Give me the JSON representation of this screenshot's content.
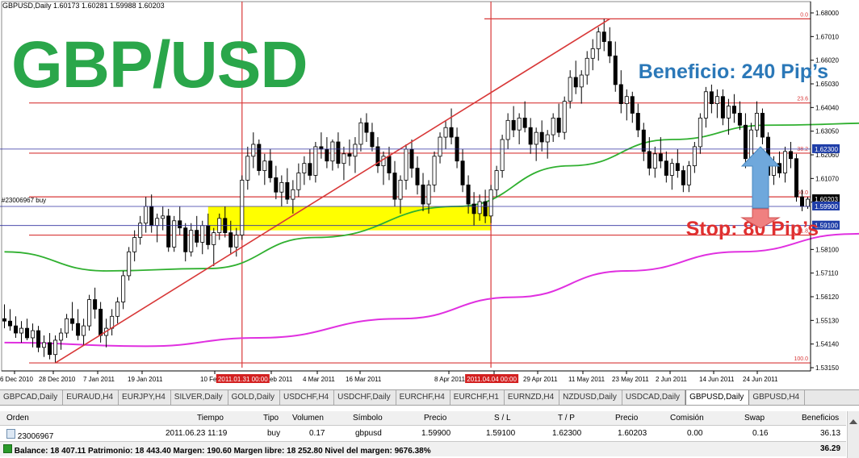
{
  "chart_header": "GBPUSD,Daily  1.60173 1.60281 1.59988 1.60203",
  "big_title": "GBP/USD",
  "profit_label": "Beneficio: 240 Pip’s",
  "stop_label": "Stop: 80 Pip’s",
  "order_label": "#23006967 buy",
  "colors": {
    "title_green": "#2aa64a",
    "profit_blue": "#2b78b8",
    "stop_red": "#e03030",
    "fib_red": "#d83838",
    "ma_green": "#30b030",
    "ma_magenta": "#e030e0",
    "buy_zone_yellow": "#ffff00",
    "price_line_blue": "#3030a0"
  },
  "icons": [
    "up-arrow-icon",
    "down-arrow-icon",
    "order-icon",
    "balance-icon"
  ],
  "chart_data": {
    "type": "candlestick",
    "symbol": "GBPUSD",
    "timeframe": "Daily",
    "ylim": [
      1.5315,
      1.68
    ],
    "x_tick_labels": [
      "6 Dec 2010",
      "28 Dec 2010",
      "7 Jan 2011",
      "19 Jan 2011",
      "10 Feb 2011",
      "22 Feb 2011",
      "4 Mar 2011",
      "16 Mar 2011",
      "8 Apr 2011",
      "19 Apr 2011",
      "29 Apr 2011",
      "11 May 2011",
      "23 May 2011",
      "2 Jun 2011",
      "14 Jun 2011",
      "24 Jun 2011"
    ],
    "y_tick_labels": [
      "1.68000",
      "1.67010",
      "1.66020",
      "1.65030",
      "1.64040",
      "1.63050",
      "1.62060",
      "1.61070",
      "1.60080",
      "1.59090",
      "1.58100",
      "1.57110",
      "1.56120",
      "1.55130",
      "1.54140",
      "1.53150"
    ],
    "fib_levels": [
      {
        "label": "0.0",
        "price": 1.6775
      },
      {
        "label": "23.6",
        "price": 1.6423
      },
      {
        "label": "38.2",
        "price": 1.6213
      },
      {
        "label": "50.0",
        "price": 1.603
      },
      {
        "label": "61.8",
        "price": 1.587
      },
      {
        "label": "100.0",
        "price": 1.5335
      }
    ],
    "price_labels": [
      {
        "text": "1.62300",
        "price": 1.623
      },
      {
        "text": "1.60203",
        "price": 1.60203
      },
      {
        "text": "1.59900",
        "price": 1.599
      },
      {
        "text": "1.59100",
        "price": 1.591
      }
    ],
    "vertical_markers": [
      {
        "text": "2011.01.31 00:00",
        "index": 42
      },
      {
        "text": "2011.04.04 00:00",
        "index": 86
      }
    ],
    "trendline": {
      "from_index": 9,
      "from_price": 1.5335,
      "to_index": 107,
      "to_price": 1.6775
    },
    "buy_zone": {
      "from_index": 36,
      "to_index": 86,
      "low": 1.589,
      "high": 1.599
    },
    "ohlc": [
      [
        1.552,
        1.558,
        1.548,
        1.551
      ],
      [
        1.551,
        1.556,
        1.547,
        1.549
      ],
      [
        1.549,
        1.553,
        1.544,
        1.546
      ],
      [
        1.546,
        1.551,
        1.542,
        1.548
      ],
      [
        1.548,
        1.552,
        1.543,
        1.544
      ],
      [
        1.544,
        1.55,
        1.54,
        1.547
      ],
      [
        1.547,
        1.549,
        1.538,
        1.54
      ],
      [
        1.54,
        1.545,
        1.536,
        1.542
      ],
      [
        1.542,
        1.546,
        1.535,
        1.537
      ],
      [
        1.537,
        1.545,
        1.5335,
        1.543
      ],
      [
        1.543,
        1.548,
        1.539,
        1.546
      ],
      [
        1.546,
        1.554,
        1.544,
        1.552
      ],
      [
        1.552,
        1.559,
        1.547,
        1.55
      ],
      [
        1.55,
        1.556,
        1.543,
        1.545
      ],
      [
        1.545,
        1.552,
        1.541,
        1.549
      ],
      [
        1.549,
        1.562,
        1.547,
        1.56
      ],
      [
        1.56,
        1.565,
        1.552,
        1.556
      ],
      [
        1.556,
        1.559,
        1.542,
        1.545
      ],
      [
        1.545,
        1.552,
        1.54,
        1.548
      ],
      [
        1.548,
        1.556,
        1.545,
        1.553
      ],
      [
        1.553,
        1.561,
        1.55,
        1.559
      ],
      [
        1.559,
        1.572,
        1.556,
        1.57
      ],
      [
        1.57,
        1.582,
        1.568,
        1.58
      ],
      [
        1.58,
        1.589,
        1.576,
        1.586
      ],
      [
        1.586,
        1.595,
        1.583,
        1.592
      ],
      [
        1.592,
        1.603,
        1.588,
        1.599
      ],
      [
        1.599,
        1.604,
        1.588,
        1.591
      ],
      [
        1.591,
        1.596,
        1.584,
        1.594
      ],
      [
        1.594,
        1.599,
        1.589,
        1.595
      ],
      [
        1.595,
        1.598,
        1.58,
        1.582
      ],
      [
        1.582,
        1.595,
        1.58,
        1.593
      ],
      [
        1.593,
        1.599,
        1.587,
        1.59
      ],
      [
        1.59,
        1.592,
        1.576,
        1.58
      ],
      [
        1.58,
        1.592,
        1.578,
        1.589
      ],
      [
        1.589,
        1.595,
        1.582,
        1.584
      ],
      [
        1.584,
        1.593,
        1.579,
        1.591
      ],
      [
        1.591,
        1.596,
        1.581,
        1.583
      ],
      [
        1.583,
        1.59,
        1.574,
        1.588
      ],
      [
        1.588,
        1.596,
        1.585,
        1.594
      ],
      [
        1.594,
        1.599,
        1.586,
        1.588
      ],
      [
        1.588,
        1.593,
        1.579,
        1.582
      ],
      [
        1.582,
        1.59,
        1.578,
        1.587
      ],
      [
        1.587,
        1.612,
        1.585,
        1.61
      ],
      [
        1.61,
        1.624,
        1.606,
        1.62
      ],
      [
        1.62,
        1.63,
        1.615,
        1.625
      ],
      [
        1.625,
        1.627,
        1.612,
        1.614
      ],
      [
        1.614,
        1.621,
        1.608,
        1.618
      ],
      [
        1.618,
        1.623,
        1.609,
        1.611
      ],
      [
        1.611,
        1.616,
        1.602,
        1.605
      ],
      [
        1.605,
        1.612,
        1.599,
        1.609
      ],
      [
        1.609,
        1.615,
        1.6,
        1.602
      ],
      [
        1.602,
        1.61,
        1.596,
        1.606
      ],
      [
        1.606,
        1.617,
        1.603,
        1.613
      ],
      [
        1.613,
        1.62,
        1.608,
        1.617
      ],
      [
        1.617,
        1.623,
        1.61,
        1.612
      ],
      [
        1.612,
        1.626,
        1.609,
        1.624
      ],
      [
        1.624,
        1.63,
        1.619,
        1.623
      ],
      [
        1.623,
        1.628,
        1.615,
        1.618
      ],
      [
        1.618,
        1.627,
        1.614,
        1.626
      ],
      [
        1.626,
        1.63,
        1.615,
        1.617
      ],
      [
        1.617,
        1.624,
        1.61,
        1.621
      ],
      [
        1.621,
        1.627,
        1.616,
        1.62
      ],
      [
        1.62,
        1.628,
        1.613,
        1.625
      ],
      [
        1.625,
        1.636,
        1.622,
        1.634
      ],
      [
        1.634,
        1.638,
        1.626,
        1.63
      ],
      [
        1.63,
        1.634,
        1.622,
        1.624
      ],
      [
        1.624,
        1.628,
        1.613,
        1.616
      ],
      [
        1.616,
        1.622,
        1.608,
        1.62
      ],
      [
        1.62,
        1.624,
        1.61,
        1.613
      ],
      [
        1.613,
        1.618,
        1.599,
        1.602
      ],
      [
        1.602,
        1.612,
        1.596,
        1.61
      ],
      [
        1.61,
        1.625,
        1.606,
        1.623
      ],
      [
        1.623,
        1.627,
        1.611,
        1.615
      ],
      [
        1.615,
        1.62,
        1.604,
        1.608
      ],
      [
        1.608,
        1.613,
        1.597,
        1.6
      ],
      [
        1.6,
        1.61,
        1.596,
        1.608
      ],
      [
        1.608,
        1.622,
        1.605,
        1.62
      ],
      [
        1.62,
        1.63,
        1.617,
        1.628
      ],
      [
        1.628,
        1.635,
        1.623,
        1.632
      ],
      [
        1.632,
        1.64,
        1.625,
        1.628
      ],
      [
        1.628,
        1.632,
        1.615,
        1.618
      ],
      [
        1.618,
        1.623,
        1.605,
        1.608
      ],
      [
        1.608,
        1.612,
        1.596,
        1.6
      ],
      [
        1.6,
        1.605,
        1.591,
        1.596
      ],
      [
        1.596,
        1.604,
        1.593,
        1.601
      ],
      [
        1.601,
        1.606,
        1.592,
        1.595
      ],
      [
        1.595,
        1.608,
        1.592,
        1.606
      ],
      [
        1.606,
        1.616,
        1.603,
        1.614
      ],
      [
        1.614,
        1.629,
        1.611,
        1.627
      ],
      [
        1.627,
        1.638,
        1.623,
        1.635
      ],
      [
        1.635,
        1.641,
        1.628,
        1.631
      ],
      [
        1.631,
        1.638,
        1.625,
        1.636
      ],
      [
        1.636,
        1.643,
        1.63,
        1.632
      ],
      [
        1.632,
        1.636,
        1.621,
        1.625
      ],
      [
        1.625,
        1.632,
        1.618,
        1.63
      ],
      [
        1.63,
        1.635,
        1.622,
        1.626
      ],
      [
        1.626,
        1.631,
        1.619,
        1.629
      ],
      [
        1.629,
        1.638,
        1.626,
        1.636
      ],
      [
        1.636,
        1.642,
        1.628,
        1.63
      ],
      [
        1.63,
        1.645,
        1.627,
        1.643
      ],
      [
        1.643,
        1.656,
        1.64,
        1.653
      ],
      [
        1.653,
        1.66,
        1.646,
        1.649
      ],
      [
        1.649,
        1.656,
        1.642,
        1.654
      ],
      [
        1.654,
        1.664,
        1.65,
        1.661
      ],
      [
        1.661,
        1.669,
        1.656,
        1.665
      ],
      [
        1.665,
        1.674,
        1.66,
        1.672
      ],
      [
        1.672,
        1.6775,
        1.664,
        1.668
      ],
      [
        1.668,
        1.674,
        1.659,
        1.662
      ],
      [
        1.662,
        1.668,
        1.647,
        1.65
      ],
      [
        1.65,
        1.656,
        1.638,
        1.642
      ],
      [
        1.642,
        1.648,
        1.635,
        1.645
      ],
      [
        1.645,
        1.647,
        1.634,
        1.638
      ],
      [
        1.638,
        1.642,
        1.628,
        1.631
      ],
      [
        1.631,
        1.634,
        1.618,
        1.622
      ],
      [
        1.622,
        1.628,
        1.612,
        1.615
      ],
      [
        1.615,
        1.624,
        1.611,
        1.621
      ],
      [
        1.621,
        1.628,
        1.615,
        1.618
      ],
      [
        1.618,
        1.622,
        1.609,
        1.612
      ],
      [
        1.612,
        1.619,
        1.606,
        1.617
      ],
      [
        1.617,
        1.623,
        1.611,
        1.614
      ],
      [
        1.614,
        1.616,
        1.605,
        1.608
      ],
      [
        1.608,
        1.618,
        1.605,
        1.616
      ],
      [
        1.616,
        1.626,
        1.613,
        1.624
      ],
      [
        1.624,
        1.638,
        1.621,
        1.636
      ],
      [
        1.636,
        1.649,
        1.632,
        1.647
      ],
      [
        1.647,
        1.65,
        1.638,
        1.642
      ],
      [
        1.642,
        1.648,
        1.636,
        1.645
      ],
      [
        1.645,
        1.648,
        1.633,
        1.636
      ],
      [
        1.636,
        1.644,
        1.629,
        1.641
      ],
      [
        1.641,
        1.646,
        1.634,
        1.638
      ],
      [
        1.638,
        1.643,
        1.631,
        1.633
      ],
      [
        1.633,
        1.638,
        1.615,
        1.619
      ],
      [
        1.619,
        1.634,
        1.617,
        1.631
      ],
      [
        1.631,
        1.643,
        1.628,
        1.638
      ],
      [
        1.638,
        1.64,
        1.625,
        1.628
      ],
      [
        1.628,
        1.63,
        1.609,
        1.612
      ],
      [
        1.612,
        1.62,
        1.608,
        1.617
      ],
      [
        1.617,
        1.622,
        1.611,
        1.613
      ],
      [
        1.613,
        1.624,
        1.609,
        1.622
      ],
      [
        1.622,
        1.626,
        1.615,
        1.619
      ],
      [
        1.619,
        1.621,
        1.601,
        1.603
      ],
      [
        1.603,
        1.606,
        1.597,
        1.599
      ],
      [
        1.599,
        1.603,
        1.598,
        1.60203
      ]
    ],
    "ma_green_endpoints": [
      {
        "index": 0,
        "price": 1.58
      },
      {
        "index": 18,
        "price": 1.572
      },
      {
        "index": 36,
        "price": 1.573
      },
      {
        "index": 55,
        "price": 1.586
      },
      {
        "index": 80,
        "price": 1.599
      },
      {
        "index": 100,
        "price": 1.616
      },
      {
        "index": 118,
        "price": 1.627
      },
      {
        "index": 135,
        "price": 1.633
      },
      {
        "index": 158,
        "price": 1.634
      }
    ],
    "ma_magenta_endpoints": [
      {
        "index": 0,
        "price": 1.542
      },
      {
        "index": 25,
        "price": 1.5405
      },
      {
        "index": 45,
        "price": 1.544
      },
      {
        "index": 70,
        "price": 1.552
      },
      {
        "index": 90,
        "price": 1.561
      },
      {
        "index": 110,
        "price": 1.572
      },
      {
        "index": 130,
        "price": 1.58
      },
      {
        "index": 150,
        "price": 1.5875
      },
      {
        "index": 158,
        "price": 1.589
      }
    ]
  },
  "tabs": [
    "GBPCAD,Daily",
    "EURAUD,H4",
    "EURJPY,H4",
    "SILVER,Daily",
    "GOLD,Daily",
    "USDCHF,H4",
    "USDCHF,Daily",
    "EURCHF,H4",
    "EURCHF,H1",
    "EURNZD,H4",
    "NZDUSD,Daily",
    "USDCAD,Daily",
    "GBPUSD,Daily",
    "GBPUSD,H4"
  ],
  "active_tab": "GBPUSD,Daily",
  "terminal": {
    "headers": {
      "orden": "Orden",
      "tiempo": "Tiempo",
      "tipo": "Tipo",
      "volumen": "Volumen",
      "simbolo": "Símbolo",
      "precio": "Precio",
      "sl": "S / L",
      "tp": "T / P",
      "precio2": "Precio",
      "comision": "Comisión",
      "swap": "Swap",
      "beneficios": "Beneficios"
    },
    "order": {
      "orden": "23006967",
      "tiempo": "2011.06.23 11:19",
      "tipo": "buy",
      "volumen": "0.17",
      "simbolo": "gbpusd",
      "precio": "1.59900",
      "sl": "1.59100",
      "tp": "1.62300",
      "precio2": "1.60203",
      "comision": "0.00",
      "swap": "0.16",
      "beneficios": "36.13"
    },
    "balance_text": "Balance: 18 407.11  Patrimonio: 18 443.40  Margen: 190.60  Margen libre: 18 252.80  Nivel del margen: 9676.38%",
    "balance_profit": "36.29"
  }
}
